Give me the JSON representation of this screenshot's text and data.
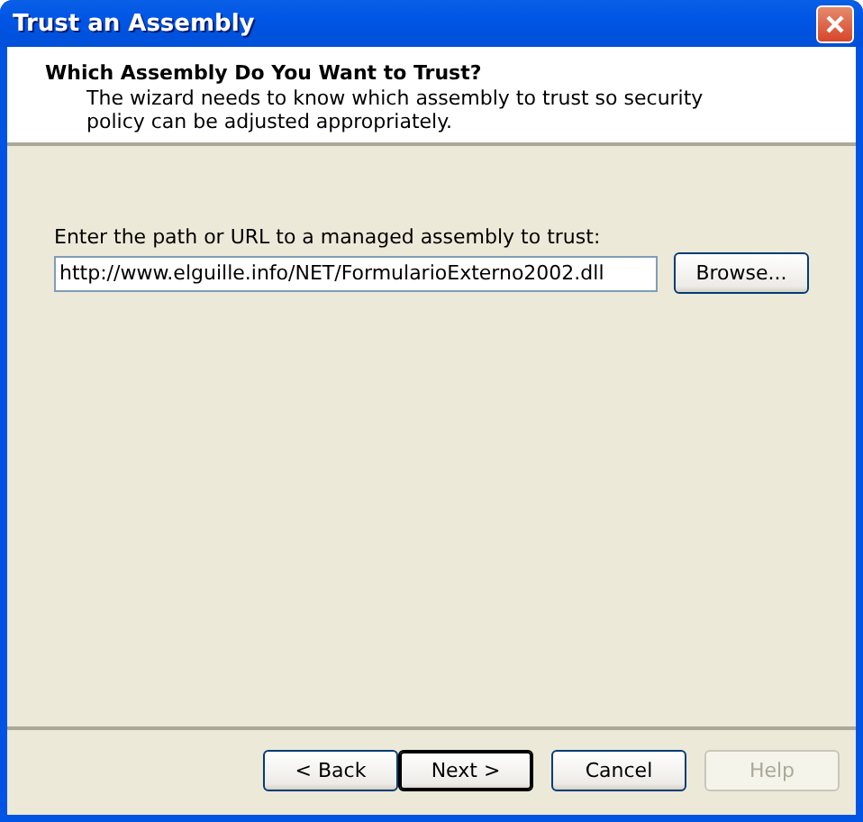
{
  "window": {
    "title": "Trust an Assembly"
  },
  "header": {
    "title": "Which Assembly Do You Want to Trust?",
    "description": "The wizard needs to know which assembly to trust so security policy can be adjusted appropriately."
  },
  "path_field": {
    "label": "Enter the path or URL to a managed assembly to trust:",
    "value": "http://www.elguille.info/NET/FormularioExterno2002.dll"
  },
  "browse_button": {
    "label": "Browse..."
  },
  "buttons": [
    {
      "label": "< Back",
      "default": false,
      "disabled": false
    },
    {
      "label": "Next >",
      "default": true,
      "disabled": false
    },
    {
      "label": "Cancel",
      "default": false,
      "disabled": false
    },
    {
      "label": "Help",
      "default": false,
      "disabled": true
    }
  ]
}
